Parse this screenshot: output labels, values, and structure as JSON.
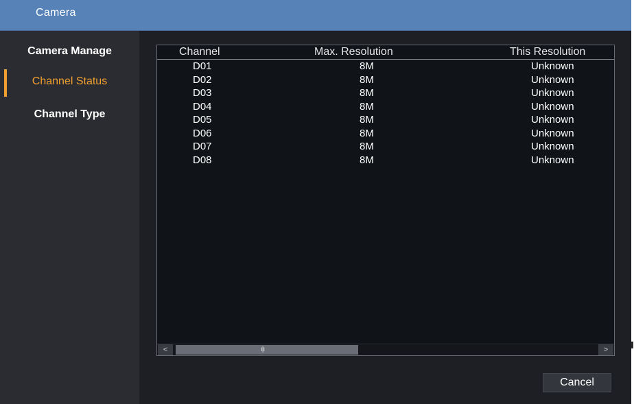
{
  "window": {
    "title": "Camera"
  },
  "sidebar": {
    "items": [
      {
        "label": "Camera Manage",
        "active": false
      },
      {
        "label": "Channel Status",
        "active": true
      },
      {
        "label": "Channel Type",
        "active": false
      }
    ]
  },
  "table": {
    "columns": [
      "Channel",
      "Max. Resolution",
      "This Resolution"
    ],
    "rows": [
      {
        "channel": "D01",
        "max_resolution": "8M",
        "this_resolution": "Unknown"
      },
      {
        "channel": "D02",
        "max_resolution": "8M",
        "this_resolution": "Unknown"
      },
      {
        "channel": "D03",
        "max_resolution": "8M",
        "this_resolution": "Unknown"
      },
      {
        "channel": "D04",
        "max_resolution": "8M",
        "this_resolution": "Unknown"
      },
      {
        "channel": "D05",
        "max_resolution": "8M",
        "this_resolution": "Unknown"
      },
      {
        "channel": "D06",
        "max_resolution": "8M",
        "this_resolution": "Unknown"
      },
      {
        "channel": "D07",
        "max_resolution": "8M",
        "this_resolution": "Unknown"
      },
      {
        "channel": "D08",
        "max_resolution": "8M",
        "this_resolution": "Unknown"
      }
    ],
    "scrollbar": {
      "left_arrow": "<",
      "right_arrow": ">",
      "grip": "ı|ı"
    }
  },
  "footer": {
    "cancel_label": "Cancel"
  },
  "colors": {
    "titlebar": "#5782b8",
    "sidebar_bg": "#2b2c31",
    "main_bg": "#1e1f24",
    "table_bg": "#101318",
    "active_accent": "#f0a030",
    "text": "#ffffff"
  }
}
